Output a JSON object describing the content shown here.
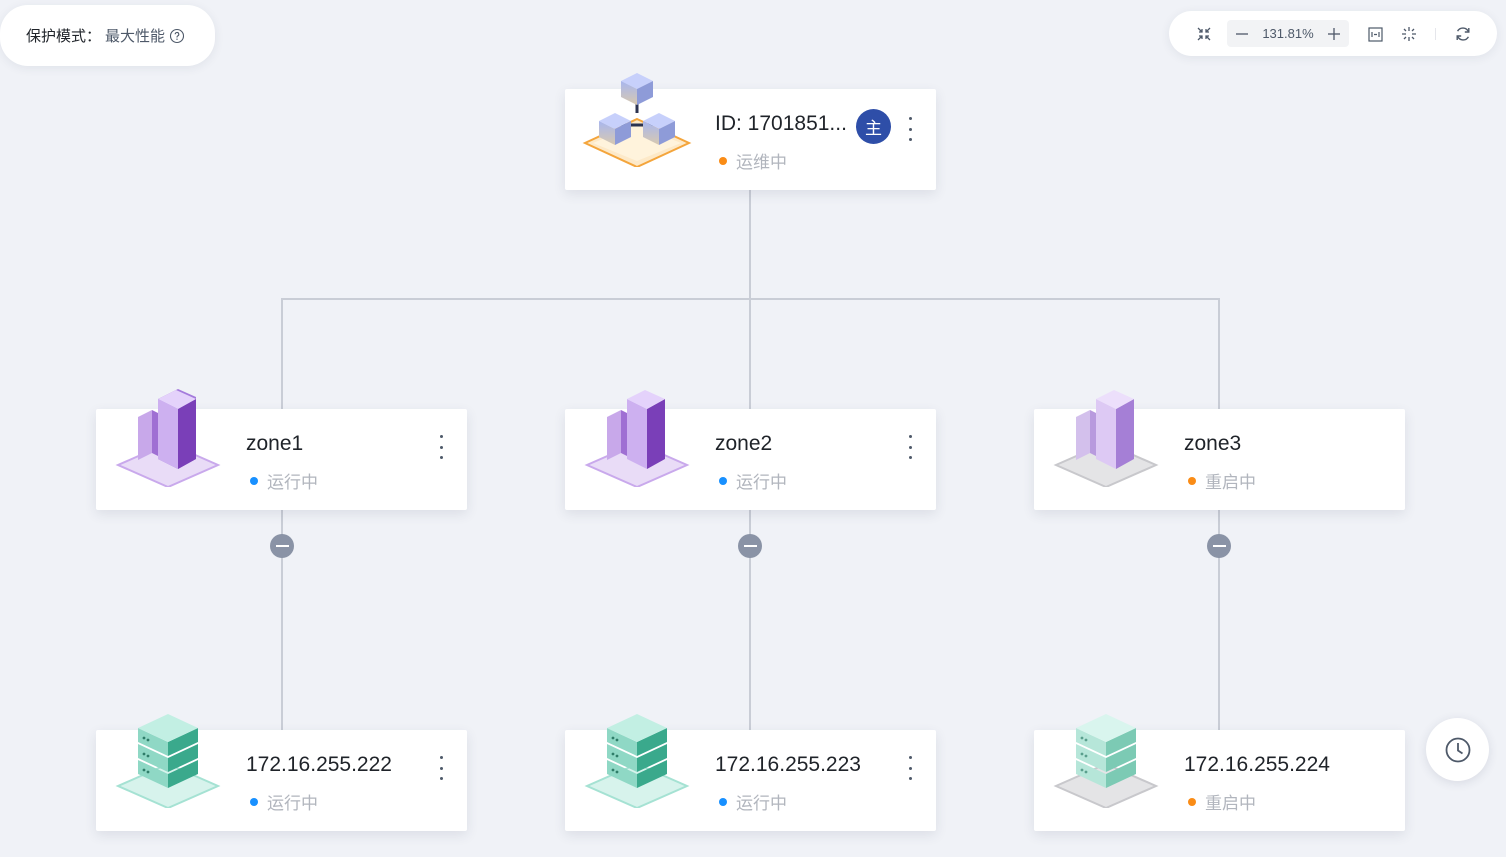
{
  "mode": {
    "label": "保护模式：",
    "value": "最大性能",
    "help_icon": "question-circle-icon"
  },
  "toolbar": {
    "zoom_value": "131.81%",
    "icons": [
      "fullscreen-icon",
      "zoom-out-icon",
      "zoom-in-icon",
      "fit-view-icon",
      "center-icon",
      "refresh-icon"
    ]
  },
  "colors": {
    "running": "#1890ff",
    "warning": "#fa8c16",
    "badge": "#2e4ea8",
    "background": "#f0f2f7"
  },
  "cluster": {
    "title": "ID: 1701851...",
    "badge": "主",
    "status": "运维中",
    "status_color": "warning",
    "icon": "cluster-cubes-icon"
  },
  "zones": [
    {
      "name": "zone1",
      "status": "运行中",
      "status_color": "running",
      "icon": "zone-building-icon"
    },
    {
      "name": "zone2",
      "status": "运行中",
      "status_color": "running",
      "icon": "zone-building-icon"
    },
    {
      "name": "zone3",
      "status": "重启中",
      "status_color": "warning",
      "icon": "zone-building-icon"
    }
  ],
  "servers": [
    {
      "ip": "172.16.255.222",
      "status": "运行中",
      "status_color": "running",
      "icon": "server-stack-icon"
    },
    {
      "ip": "172.16.255.223",
      "status": "运行中",
      "status_color": "running",
      "icon": "server-stack-icon"
    },
    {
      "ip": "172.16.255.224",
      "status": "重启中",
      "status_color": "warning",
      "icon": "server-stack-icon"
    }
  ],
  "history_icon": "clock-icon"
}
